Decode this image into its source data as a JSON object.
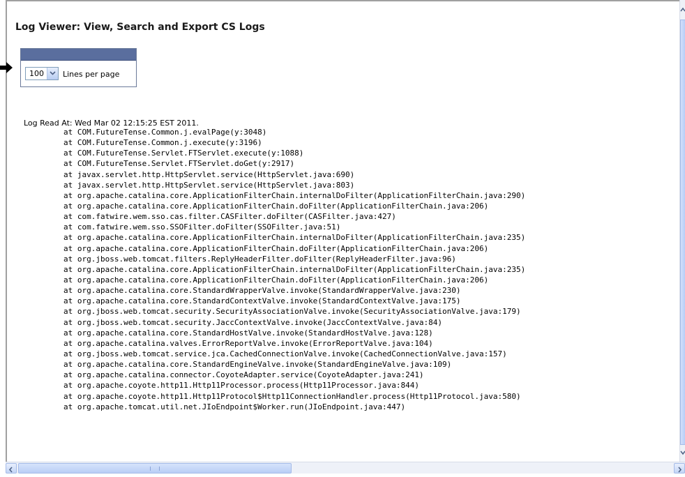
{
  "page": {
    "title": "Log Viewer: View, Search and Export CS Logs"
  },
  "pager": {
    "selected_value": "100",
    "label": "Lines per page"
  },
  "log": {
    "read_at": "Log Read At: Wed Mar 02 12:15:25 EST 2011.",
    "trace_lines": [
      "at COM.FutureTense.Common.j.evalPage(y:3048)",
      "at COM.FutureTense.Common.j.execute(y:3196)",
      "at COM.FutureTense.Servlet.FTServlet.execute(y:1088)",
      "at COM.FutureTense.Servlet.FTServlet.doGet(y:2917)",
      "at javax.servlet.http.HttpServlet.service(HttpServlet.java:690)",
      "at javax.servlet.http.HttpServlet.service(HttpServlet.java:803)",
      "at org.apache.catalina.core.ApplicationFilterChain.internalDoFilter(ApplicationFilterChain.java:290)",
      "at org.apache.catalina.core.ApplicationFilterChain.doFilter(ApplicationFilterChain.java:206)",
      "at com.fatwire.wem.sso.cas.filter.CASFilter.doFilter(CASFilter.java:427)",
      "at com.fatwire.wem.sso.SSOFilter.doFilter(SSOFilter.java:51)",
      "at org.apache.catalina.core.ApplicationFilterChain.internalDoFilter(ApplicationFilterChain.java:235)",
      "at org.apache.catalina.core.ApplicationFilterChain.doFilter(ApplicationFilterChain.java:206)",
      "at org.jboss.web.tomcat.filters.ReplyHeaderFilter.doFilter(ReplyHeaderFilter.java:96)",
      "at org.apache.catalina.core.ApplicationFilterChain.internalDoFilter(ApplicationFilterChain.java:235)",
      "at org.apache.catalina.core.ApplicationFilterChain.doFilter(ApplicationFilterChain.java:206)",
      "at org.apache.catalina.core.StandardWrapperValve.invoke(StandardWrapperValve.java:230)",
      "at org.apache.catalina.core.StandardContextValve.invoke(StandardContextValve.java:175)",
      "at org.jboss.web.tomcat.security.SecurityAssociationValve.invoke(SecurityAssociationValve.java:179)",
      "at org.jboss.web.tomcat.security.JaccContextValve.invoke(JaccContextValve.java:84)",
      "at org.apache.catalina.core.StandardHostValve.invoke(StandardHostValve.java:128)",
      "at org.apache.catalina.valves.ErrorReportValve.invoke(ErrorReportValve.java:104)",
      "at org.jboss.web.tomcat.service.jca.CachedConnectionValve.invoke(CachedConnectionValve.java:157)",
      "at org.apache.catalina.core.StandardEngineValve.invoke(StandardEngineValve.java:109)",
      "at org.apache.catalina.connector.CoyoteAdapter.service(CoyoteAdapter.java:241)",
      "at org.apache.coyote.http11.Http11Processor.process(Http11Processor.java:844)",
      "at org.apache.coyote.http11.Http11Protocol$Http11ConnectionHandler.process(Http11Protocol.java:580)",
      "at org.apache.tomcat.util.net.JIoEndpoint$Worker.run(JIoEndpoint.java:447)"
    ]
  },
  "colors": {
    "pager_header": "#5a6e9e",
    "scrollbar": "#b8cdf7"
  },
  "icons": {
    "pointer": "callout-arrow-icon",
    "dropdown": "chevron-down-icon"
  }
}
